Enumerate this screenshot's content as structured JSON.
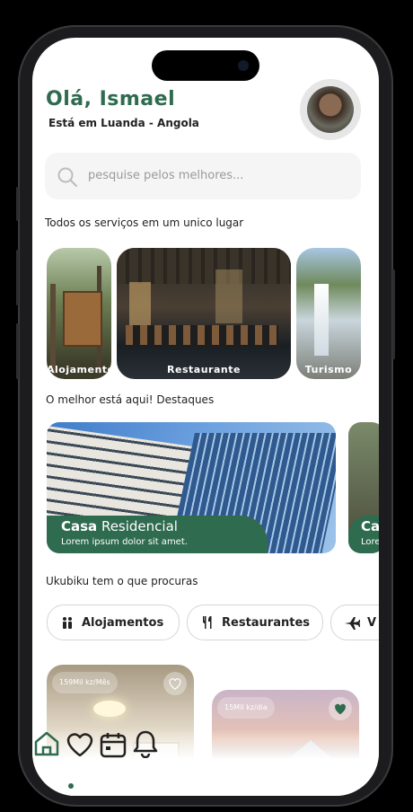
{
  "greeting": "Olá, Ismael",
  "location": "Está em Luanda - Angola",
  "search": {
    "placeholder": "pesquise pelos melhores..."
  },
  "sections": {
    "services_title": "Todos os serviços em um unico lugar",
    "highlights_title": "O melhor está aqui! Destaques",
    "filters_title": "Ukubiku tem o que procuras"
  },
  "categories": [
    "Alojamento",
    "Restaurante",
    "Turismo"
  ],
  "highlight": {
    "title_bold": "Casa",
    "title_rest": " Residencial",
    "subtitle": "Lorem ipsum dolor sit amet.",
    "peek_title": "Ca",
    "peek_sub": "Lore"
  },
  "filters": [
    "Alojamentos",
    "Restaurantes",
    "V"
  ],
  "listings": [
    {
      "price": "159Mil kz/Mês",
      "favorite": false
    },
    {
      "price": "15Mil kz/dia",
      "favorite": true
    }
  ],
  "colors": {
    "brand": "#2f6b4f"
  },
  "nav": [
    "home-icon",
    "heart-icon",
    "calendar-icon",
    "bell-icon"
  ]
}
